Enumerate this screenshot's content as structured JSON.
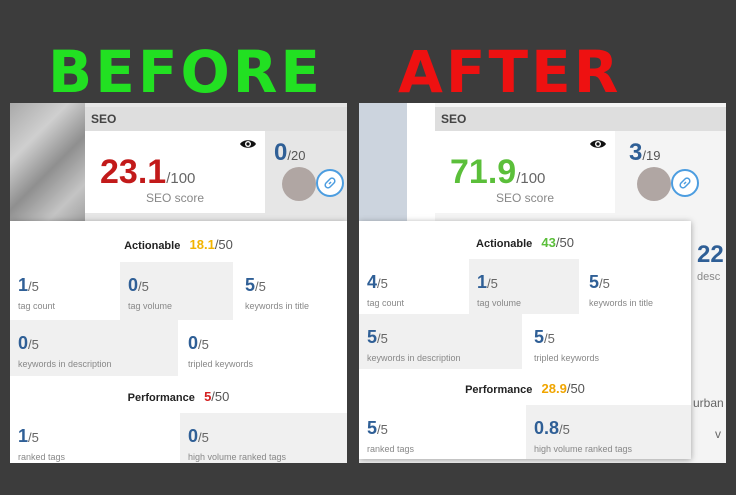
{
  "before": {
    "heading": "BEFORE",
    "seo_header": "SEO",
    "score": "23.1",
    "score_max": "/100",
    "score_label": "SEO score",
    "side_score": "0",
    "side_max": "/20",
    "actionable": {
      "label": "Actionable",
      "value": "18.1",
      "max": "/50"
    },
    "actionable_items": [
      {
        "value": "1",
        "max": "/5",
        "label": "tag count"
      },
      {
        "value": "0",
        "max": "/5",
        "label": "tag volume"
      },
      {
        "value": "5",
        "max": "/5",
        "label": "keywords in title"
      },
      {
        "value": "0",
        "max": "/5",
        "label": "keywords in description"
      },
      {
        "value": "0",
        "max": "/5",
        "label": "tripled keywords"
      }
    ],
    "performance": {
      "label": "Performance",
      "value": "5",
      "max": "/50"
    },
    "performance_items": [
      {
        "value": "1",
        "max": "/5",
        "label": "ranked tags"
      },
      {
        "value": "0",
        "max": "/5",
        "label": "high volume ranked tags"
      }
    ]
  },
  "after": {
    "heading": "AFTER",
    "seo_header": "SEO",
    "score": "71.9",
    "score_max": "/100",
    "score_label": "SEO score",
    "side_score": "3",
    "side_max": "/19",
    "background_number": "22",
    "background_label": "desc",
    "background_text_1": "urban",
    "background_text_2": "v",
    "actionable": {
      "label": "Actionable",
      "value": "43",
      "max": "/50"
    },
    "actionable_items": [
      {
        "value": "4",
        "max": "/5",
        "label": "tag count"
      },
      {
        "value": "1",
        "max": "/5",
        "label": "tag volume"
      },
      {
        "value": "5",
        "max": "/5",
        "label": "keywords in title"
      },
      {
        "value": "5",
        "max": "/5",
        "label": "keywords in description"
      },
      {
        "value": "5",
        "max": "/5",
        "label": "tripled keywords"
      }
    ],
    "performance": {
      "label": "Performance",
      "value": "28.9",
      "max": "/50"
    },
    "performance_items": [
      {
        "value": "5",
        "max": "/5",
        "label": "ranked tags"
      },
      {
        "value": "0.8",
        "max": "/5",
        "label": "high volume ranked tags"
      }
    ]
  },
  "colors": {
    "before_heading": "#22e022",
    "after_heading": "#ee1111",
    "score_before": "#c21a1a",
    "score_after": "#5bbf3a",
    "metric_blue": "#2f5f96",
    "actionable_before": "#f2b400",
    "actionable_after": "#5bbf3a",
    "performance_before": "#d42020",
    "performance_after": "#f0a500"
  }
}
